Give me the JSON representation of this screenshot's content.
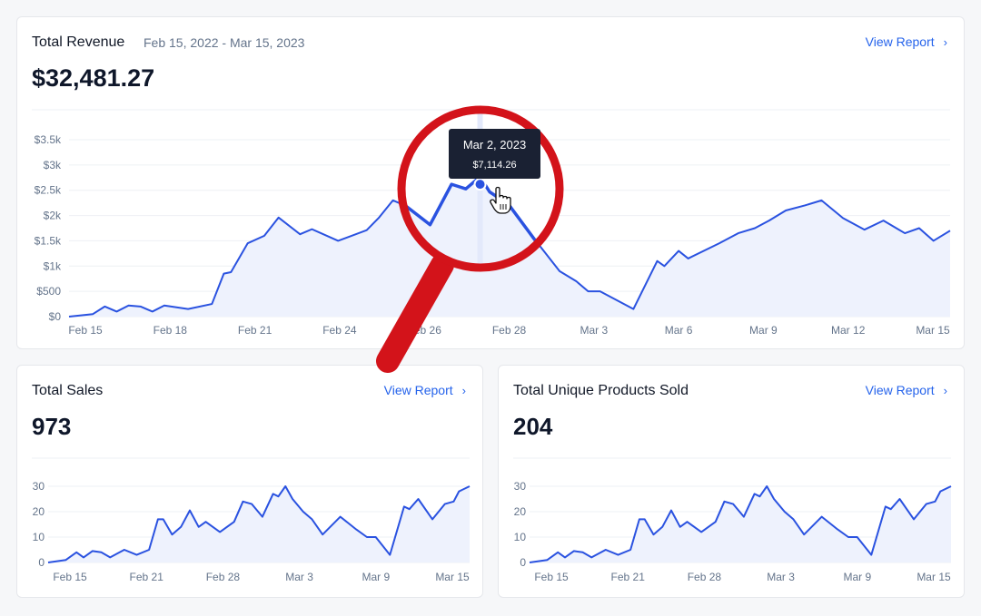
{
  "revenue_card": {
    "title": "Total Revenue",
    "date_range": "Feb 15, 2022 - Mar 15, 2023",
    "value": "$32,481.27",
    "view_report": "View Report",
    "tooltip": {
      "date": "Mar 2, 2023",
      "value": "$7,114.26"
    }
  },
  "sales_card": {
    "title": "Total Sales",
    "value": "973",
    "view_report": "View Report"
  },
  "products_card": {
    "title": "Total Unique Products Sold",
    "value": "204",
    "view_report": "View Report"
  },
  "icons": {
    "chevron": "chevron-right-icon",
    "cursor": "hand-pointer-icon",
    "magnifier": "magnifying-glass-overlay"
  },
  "colors": {
    "accent": "#2563eb",
    "line": "#2a52e0",
    "fill": "#eef2fd",
    "magnifier": "#d3131a",
    "tooltip_bg": "#1a2133"
  },
  "chart_data": [
    {
      "type": "area",
      "ylim": [
        0,
        3500
      ],
      "y_ticks": [
        0,
        500,
        1000,
        1500,
        2000,
        2500,
        3000,
        3500
      ],
      "y_tick_labels": [
        "$0",
        "$500",
        "$1k",
        "$1.5k",
        "$2k",
        "$2.5k",
        "$3k",
        "$3.5k"
      ],
      "x_tick_labels": [
        "Feb 15",
        "Feb 18",
        "Feb 21",
        "Feb 24",
        "Feb 26",
        "Feb 28",
        "Mar 3",
        "Mar 6",
        "Mar 9",
        "Mar 12",
        "Mar 15"
      ],
      "grid": true,
      "points": [
        {
          "x": 0,
          "y": 0
        },
        {
          "x": 1,
          "y": 50
        },
        {
          "x": 1.5,
          "y": 200
        },
        {
          "x": 2,
          "y": 100
        },
        {
          "x": 2.5,
          "y": 220
        },
        {
          "x": 3,
          "y": 200
        },
        {
          "x": 3.5,
          "y": 100
        },
        {
          "x": 4,
          "y": 220
        },
        {
          "x": 5,
          "y": 150
        },
        {
          "x": 6,
          "y": 250
        },
        {
          "x": 6.5,
          "y": 850
        },
        {
          "x": 6.8,
          "y": 880
        },
        {
          "x": 7.5,
          "y": 1450
        },
        {
          "x": 8.2,
          "y": 1600
        },
        {
          "x": 8.8,
          "y": 1960
        },
        {
          "x": 9.7,
          "y": 1630
        },
        {
          "x": 10.2,
          "y": 1730
        },
        {
          "x": 11.3,
          "y": 1500
        },
        {
          "x": 12.5,
          "y": 1710
        },
        {
          "x": 13,
          "y": 1950
        },
        {
          "x": 13.6,
          "y": 2300
        },
        {
          "x": 14.1,
          "y": 2200
        },
        {
          "x": 15.2,
          "y": 1800
        },
        {
          "x": 16.1,
          "y": 2600
        },
        {
          "x": 16.7,
          "y": 2510
        },
        {
          "x": 17.3,
          "y": 2750
        },
        {
          "x": 17.7,
          "y": 2450
        },
        {
          "x": 18.5,
          "y": 2200
        },
        {
          "x": 19.6,
          "y": 1500
        },
        {
          "x": 20.6,
          "y": 900
        },
        {
          "x": 21.3,
          "y": 700
        },
        {
          "x": 21.8,
          "y": 500
        },
        {
          "x": 22.3,
          "y": 500
        },
        {
          "x": 23.7,
          "y": 150
        },
        {
          "x": 24.7,
          "y": 1100
        },
        {
          "x": 25,
          "y": 1000
        },
        {
          "x": 25.6,
          "y": 1300
        },
        {
          "x": 26,
          "y": 1150
        },
        {
          "x": 27.3,
          "y": 1450
        },
        {
          "x": 28.1,
          "y": 1650
        },
        {
          "x": 28.8,
          "y": 1750
        },
        {
          "x": 29.4,
          "y": 1900
        },
        {
          "x": 30.1,
          "y": 2100
        },
        {
          "x": 30.9,
          "y": 2200
        },
        {
          "x": 31.6,
          "y": 2300
        },
        {
          "x": 32.5,
          "y": 1950
        },
        {
          "x": 33.4,
          "y": 1720
        },
        {
          "x": 34.2,
          "y": 1900
        },
        {
          "x": 35.1,
          "y": 1650
        },
        {
          "x": 35.7,
          "y": 1750
        },
        {
          "x": 36.3,
          "y": 1500
        },
        {
          "x": 37,
          "y": 1700
        }
      ],
      "highlight_point": {
        "x": 17.3,
        "y": 2600
      }
    },
    {
      "type": "area",
      "ylim": [
        0,
        30
      ],
      "y_ticks": [
        0,
        10,
        20,
        30
      ],
      "x_tick_labels": [
        "Feb 15",
        "Feb 21",
        "Feb 28",
        "Mar 3",
        "Mar 9",
        "Mar 15"
      ],
      "grid": true,
      "points": [
        {
          "x": 0,
          "y": 0
        },
        {
          "x": 1,
          "y": 1
        },
        {
          "x": 1.6,
          "y": 4
        },
        {
          "x": 2,
          "y": 2
        },
        {
          "x": 2.5,
          "y": 4.5
        },
        {
          "x": 3,
          "y": 4
        },
        {
          "x": 3.5,
          "y": 2
        },
        {
          "x": 4.3,
          "y": 5
        },
        {
          "x": 5,
          "y": 3
        },
        {
          "x": 5.7,
          "y": 5
        },
        {
          "x": 6.2,
          "y": 17
        },
        {
          "x": 6.5,
          "y": 17
        },
        {
          "x": 7,
          "y": 11
        },
        {
          "x": 7.5,
          "y": 14
        },
        {
          "x": 8,
          "y": 20.5
        },
        {
          "x": 8.5,
          "y": 14
        },
        {
          "x": 8.9,
          "y": 16
        },
        {
          "x": 9.7,
          "y": 12
        },
        {
          "x": 10.5,
          "y": 16
        },
        {
          "x": 11,
          "y": 24
        },
        {
          "x": 11.5,
          "y": 23
        },
        {
          "x": 12.1,
          "y": 18
        },
        {
          "x": 12.7,
          "y": 27
        },
        {
          "x": 13,
          "y": 26
        },
        {
          "x": 13.4,
          "y": 30
        },
        {
          "x": 13.8,
          "y": 25
        },
        {
          "x": 14.4,
          "y": 20
        },
        {
          "x": 14.9,
          "y": 17
        },
        {
          "x": 15.5,
          "y": 11
        },
        {
          "x": 16.5,
          "y": 18
        },
        {
          "x": 17.4,
          "y": 13
        },
        {
          "x": 18,
          "y": 10
        },
        {
          "x": 18.5,
          "y": 10
        },
        {
          "x": 19.3,
          "y": 3
        },
        {
          "x": 20.1,
          "y": 22
        },
        {
          "x": 20.4,
          "y": 21
        },
        {
          "x": 20.9,
          "y": 25
        },
        {
          "x": 21.7,
          "y": 17
        },
        {
          "x": 22.4,
          "y": 23
        },
        {
          "x": 22.9,
          "y": 24
        },
        {
          "x": 23.2,
          "y": 28
        },
        {
          "x": 23.8,
          "y": 30
        }
      ]
    },
    {
      "type": "area",
      "ylim": [
        0,
        30
      ],
      "y_ticks": [
        0,
        10,
        20,
        30
      ],
      "x_tick_labels": [
        "Feb 15",
        "Feb 21",
        "Feb 28",
        "Mar 3",
        "Mar 9",
        "Mar 15"
      ],
      "grid": true,
      "points": [
        {
          "x": 0,
          "y": 0
        },
        {
          "x": 1,
          "y": 1
        },
        {
          "x": 1.6,
          "y": 4
        },
        {
          "x": 2,
          "y": 2
        },
        {
          "x": 2.5,
          "y": 4.5
        },
        {
          "x": 3,
          "y": 4
        },
        {
          "x": 3.5,
          "y": 2
        },
        {
          "x": 4.3,
          "y": 5
        },
        {
          "x": 5,
          "y": 3
        },
        {
          "x": 5.7,
          "y": 5
        },
        {
          "x": 6.2,
          "y": 17
        },
        {
          "x": 6.5,
          "y": 17
        },
        {
          "x": 7,
          "y": 11
        },
        {
          "x": 7.5,
          "y": 14
        },
        {
          "x": 8,
          "y": 20.5
        },
        {
          "x": 8.5,
          "y": 14
        },
        {
          "x": 8.9,
          "y": 16
        },
        {
          "x": 9.7,
          "y": 12
        },
        {
          "x": 10.5,
          "y": 16
        },
        {
          "x": 11,
          "y": 24
        },
        {
          "x": 11.5,
          "y": 23
        },
        {
          "x": 12.1,
          "y": 18
        },
        {
          "x": 12.7,
          "y": 27
        },
        {
          "x": 13,
          "y": 26
        },
        {
          "x": 13.4,
          "y": 30
        },
        {
          "x": 13.8,
          "y": 25
        },
        {
          "x": 14.4,
          "y": 20
        },
        {
          "x": 14.9,
          "y": 17
        },
        {
          "x": 15.5,
          "y": 11
        },
        {
          "x": 16.5,
          "y": 18
        },
        {
          "x": 17.4,
          "y": 13
        },
        {
          "x": 18,
          "y": 10
        },
        {
          "x": 18.5,
          "y": 10
        },
        {
          "x": 19.3,
          "y": 3
        },
        {
          "x": 20.1,
          "y": 22
        },
        {
          "x": 20.4,
          "y": 21
        },
        {
          "x": 20.9,
          "y": 25
        },
        {
          "x": 21.7,
          "y": 17
        },
        {
          "x": 22.4,
          "y": 23
        },
        {
          "x": 22.9,
          "y": 24
        },
        {
          "x": 23.2,
          "y": 28
        },
        {
          "x": 23.8,
          "y": 30
        }
      ]
    }
  ]
}
